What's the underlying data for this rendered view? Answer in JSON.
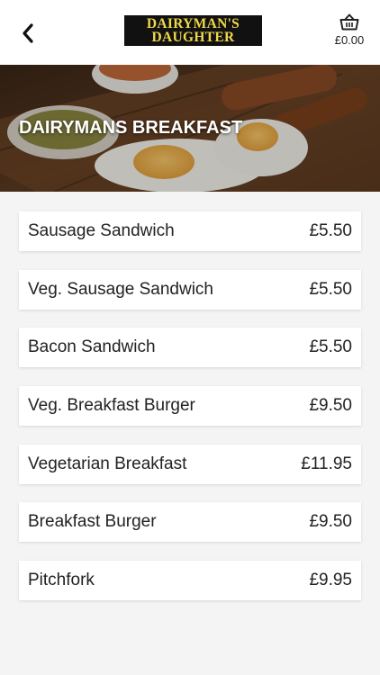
{
  "header": {
    "logo_line1": "DAIRYMAN'S",
    "logo_line2": "DAUGHTER",
    "basket_total": "£0.00"
  },
  "hero": {
    "title": "DAIRYMANS BREAKFAST"
  },
  "menu": {
    "items": [
      {
        "name": "Sausage Sandwich",
        "price": "£5.50"
      },
      {
        "name": "Veg. Sausage Sandwich",
        "price": "£5.50"
      },
      {
        "name": "Bacon Sandwich",
        "price": "£5.50"
      },
      {
        "name": "Veg. Breakfast Burger",
        "price": "£9.50"
      },
      {
        "name": "Vegetarian Breakfast",
        "price": "£11.95"
      },
      {
        "name": "Breakfast Burger",
        "price": "£9.50"
      },
      {
        "name": "Pitchfork",
        "price": "£9.95"
      }
    ]
  },
  "colors": {
    "logo_background": "#111111",
    "logo_text": "#f0d84a",
    "page_background": "#f4f4f4"
  },
  "icons": {
    "back": "chevron-left-icon",
    "basket": "basket-icon"
  }
}
